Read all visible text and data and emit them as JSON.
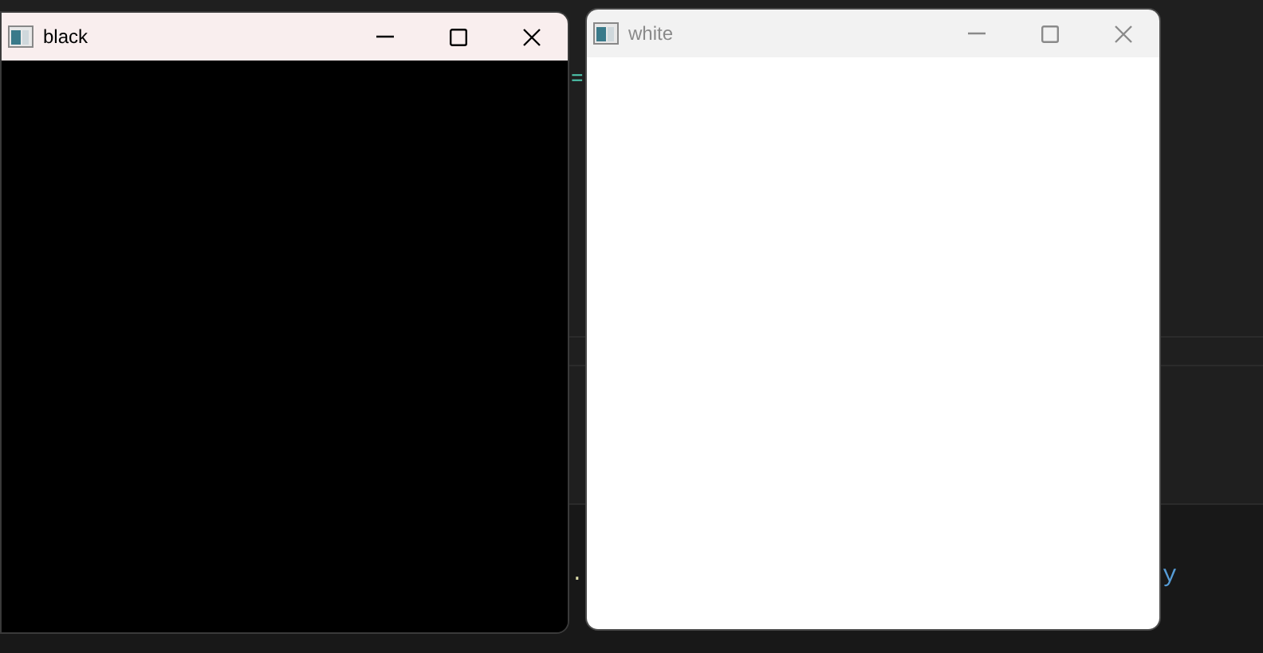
{
  "editor_fragments": [
    {
      "text": "=",
      "color": "#4ec9b0"
    },
    {
      "text": ".",
      "color": "#dcdcaa"
    },
    {
      "text": "y",
      "color": "#569cd6"
    }
  ],
  "windows": [
    {
      "title": "black",
      "active": true,
      "color": "#000000"
    },
    {
      "title": "white",
      "active": false,
      "color": "#ffffff"
    }
  ]
}
